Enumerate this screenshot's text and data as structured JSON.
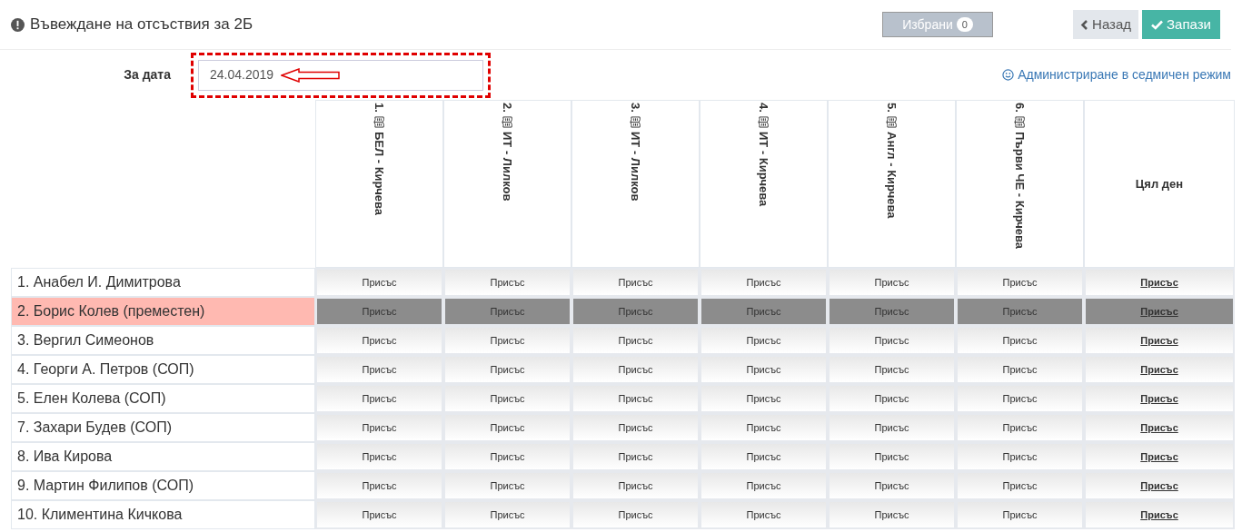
{
  "header": {
    "title": "Въвеждане на отсъствия за 2Б",
    "selected_button": {
      "label": "Избрани",
      "count": "0"
    },
    "buttons": [
      {
        "kind": "back",
        "label": "Назад"
      },
      {
        "kind": "save",
        "label": "Запази"
      }
    ]
  },
  "date_filter": {
    "label": "За дата",
    "value": "24.04.2019",
    "highlighted": true
  },
  "weekly_link": "Администриране в седмичен режим",
  "table": {
    "columns": [
      {
        "kind": "lesson",
        "number": "1.",
        "label": "БЕЛ - Кирчева"
      },
      {
        "kind": "lesson",
        "number": "2.",
        "label": "ИТ - Лилков"
      },
      {
        "kind": "lesson",
        "number": "3.",
        "label": "ИТ - Лилков"
      },
      {
        "kind": "lesson",
        "number": "4.",
        "label": "ИТ - Кирчева"
      },
      {
        "kind": "lesson",
        "number": "5.",
        "label": "Англ - Кирчева"
      },
      {
        "kind": "lesson",
        "number": "6.",
        "label": "Първи ЧЕ - Кирчева"
      },
      {
        "kind": "whole_day",
        "label": "Цял ден"
      }
    ],
    "rows": [
      {
        "name": "1. Анабел И. Димитрова",
        "moved": false,
        "cells": [
          "Присъс",
          "Присъс",
          "Присъс",
          "Присъс",
          "Присъс",
          "Присъс",
          "Присъс"
        ]
      },
      {
        "name": "2. Борис Колев (преместен)",
        "moved": true,
        "cells": [
          "Присъс",
          "Присъс",
          "Присъс",
          "Присъс",
          "Присъс",
          "Присъс",
          "Присъс"
        ]
      },
      {
        "name": "3. Вергил Симеонов",
        "moved": false,
        "cells": [
          "Присъс",
          "Присъс",
          "Присъс",
          "Присъс",
          "Присъс",
          "Присъс",
          "Присъс"
        ]
      },
      {
        "name": "4. Георги А. Петров (СОП)",
        "moved": false,
        "cells": [
          "Присъс",
          "Присъс",
          "Присъс",
          "Присъс",
          "Присъс",
          "Присъс",
          "Присъс"
        ]
      },
      {
        "name": "5. Елен Колева (СОП)",
        "moved": false,
        "cells": [
          "Присъс",
          "Присъс",
          "Присъс",
          "Присъс",
          "Присъс",
          "Присъс",
          "Присъс"
        ]
      },
      {
        "name": "7. Захари Будев (СОП)",
        "moved": false,
        "cells": [
          "Присъс",
          "Присъс",
          "Присъс",
          "Присъс",
          "Присъс",
          "Присъс",
          "Присъс"
        ]
      },
      {
        "name": "8. Ива Кирова",
        "moved": false,
        "cells": [
          "Присъс",
          "Присъс",
          "Присъс",
          "Присъс",
          "Присъс",
          "Присъс",
          "Присъс"
        ]
      },
      {
        "name": "9. Мартин Филипов (СОП)",
        "moved": false,
        "cells": [
          "Присъс",
          "Присъс",
          "Присъс",
          "Присъс",
          "Присъс",
          "Присъс",
          "Присъс"
        ]
      },
      {
        "name": "10. Климентина Кичкова",
        "moved": false,
        "cells": [
          "Присъс",
          "Присъс",
          "Присъс",
          "Присъс",
          "Присъс",
          "Присъс",
          "Присъс"
        ]
      }
    ]
  }
}
